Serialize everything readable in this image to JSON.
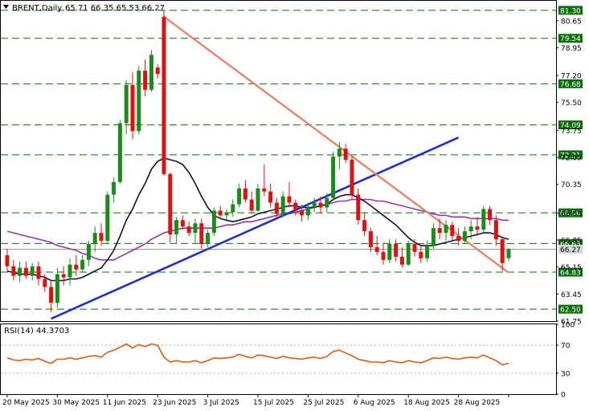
{
  "header": {
    "symbol": "BRENT,Daily",
    "ohlc": "65.71 66.35 65.53 66.27"
  },
  "rsi_header": "RSI(14) 44.3703",
  "colors": {
    "bull": "#1a8c1a",
    "bear": "#e01010",
    "sma_fast": "#101038",
    "sma_slow": "#9933b0",
    "support_line": "#1f2fd0",
    "resistance_line": "#f07a5a",
    "level_line": "#0a6e0a",
    "level_label_bg": "#0a6e0a",
    "price_label_bg": "#d8d8d8",
    "rsi_line": "#e05a10"
  },
  "chart_data": [
    {
      "type": "candlestick",
      "ylim": [
        61.75,
        81.9
      ],
      "yticks": [
        61.75,
        63.45,
        65.15,
        66.85,
        68.55,
        70.35,
        72.05,
        73.75,
        75.5,
        77.2,
        78.95,
        80.65
      ],
      "xticks": [
        {
          "label": "20 May 2025",
          "index": 0
        },
        {
          "label": "30 May 2025",
          "index": 8
        },
        {
          "label": "11 Jun 2025",
          "index": 16
        },
        {
          "label": "23 Jun 2025",
          "index": 24
        },
        {
          "label": "3 Jul 2025",
          "index": 32
        },
        {
          "label": "15 Jul 2025",
          "index": 40
        },
        {
          "label": "25 Jul 2025",
          "index": 48
        },
        {
          "label": "6 Aug 2025",
          "index": 56
        },
        {
          "label": "18 Aug 2025",
          "index": 64
        },
        {
          "label": "28 Aug 2025",
          "index": 72
        },
        {
          "label": "",
          "index": 80
        }
      ],
      "horizontal_levels": [
        81.3,
        79.54,
        76.68,
        74.09,
        72.21,
        68.56,
        66.63,
        64.83,
        62.5
      ],
      "current_price": 66.27,
      "candles": [
        {
          "o": 65.9,
          "h": 66.3,
          "l": 64.9,
          "c": 65.2
        },
        {
          "o": 65.2,
          "h": 65.6,
          "l": 64.3,
          "c": 64.6
        },
        {
          "o": 64.6,
          "h": 65.5,
          "l": 64.2,
          "c": 65.1
        },
        {
          "o": 65.1,
          "h": 65.5,
          "l": 64.4,
          "c": 64.6
        },
        {
          "o": 64.6,
          "h": 65.4,
          "l": 64.3,
          "c": 65.2
        },
        {
          "o": 65.2,
          "h": 65.5,
          "l": 64.0,
          "c": 64.4
        },
        {
          "o": 64.4,
          "h": 64.7,
          "l": 63.6,
          "c": 63.9
        },
        {
          "o": 63.9,
          "h": 64.3,
          "l": 62.3,
          "c": 62.9
        },
        {
          "o": 62.9,
          "h": 65.1,
          "l": 62.6,
          "c": 64.7
        },
        {
          "o": 64.7,
          "h": 65.2,
          "l": 64.0,
          "c": 64.5
        },
        {
          "o": 64.5,
          "h": 65.7,
          "l": 64.0,
          "c": 65.3
        },
        {
          "o": 65.3,
          "h": 65.9,
          "l": 64.6,
          "c": 65.0
        },
        {
          "o": 65.0,
          "h": 65.9,
          "l": 64.8,
          "c": 65.6
        },
        {
          "o": 65.6,
          "h": 66.8,
          "l": 65.2,
          "c": 66.6
        },
        {
          "o": 66.6,
          "h": 67.7,
          "l": 66.1,
          "c": 67.3
        },
        {
          "o": 67.3,
          "h": 67.9,
          "l": 66.5,
          "c": 66.8
        },
        {
          "o": 66.8,
          "h": 69.9,
          "l": 66.6,
          "c": 69.7
        },
        {
          "o": 69.7,
          "h": 70.8,
          "l": 69.2,
          "c": 70.5
        },
        {
          "o": 70.5,
          "h": 74.4,
          "l": 70.4,
          "c": 74.2
        },
        {
          "o": 74.2,
          "h": 76.9,
          "l": 73.5,
          "c": 76.6
        },
        {
          "o": 76.6,
          "h": 77.4,
          "l": 73.2,
          "c": 73.7
        },
        {
          "o": 73.7,
          "h": 77.8,
          "l": 73.5,
          "c": 77.5
        },
        {
          "o": 77.5,
          "h": 78.2,
          "l": 75.9,
          "c": 76.3
        },
        {
          "o": 76.3,
          "h": 78.8,
          "l": 76.2,
          "c": 78.5
        },
        {
          "o": 77.7,
          "h": 77.9,
          "l": 77.0,
          "c": 77.3
        },
        {
          "o": 80.9,
          "h": 81.3,
          "l": 70.9,
          "c": 71.0
        },
        {
          "o": 71.0,
          "h": 71.1,
          "l": 66.7,
          "c": 67.2
        },
        {
          "o": 67.2,
          "h": 68.3,
          "l": 66.6,
          "c": 68.1
        },
        {
          "o": 68.1,
          "h": 68.4,
          "l": 67.5,
          "c": 67.7
        },
        {
          "o": 67.7,
          "h": 68.0,
          "l": 67.1,
          "c": 67.3
        },
        {
          "o": 67.3,
          "h": 68.2,
          "l": 66.6,
          "c": 67.9
        },
        {
          "o": 67.9,
          "h": 68.2,
          "l": 66.3,
          "c": 66.6
        },
        {
          "o": 66.6,
          "h": 67.5,
          "l": 66.4,
          "c": 67.3
        },
        {
          "o": 67.3,
          "h": 68.9,
          "l": 67.1,
          "c": 68.7
        },
        {
          "o": 68.7,
          "h": 69.0,
          "l": 68.2,
          "c": 68.4
        },
        {
          "o": 68.4,
          "h": 68.8,
          "l": 68.0,
          "c": 68.6
        },
        {
          "o": 68.6,
          "h": 69.4,
          "l": 68.3,
          "c": 69.1
        },
        {
          "o": 69.1,
          "h": 70.4,
          "l": 68.9,
          "c": 70.1
        },
        {
          "o": 70.1,
          "h": 70.6,
          "l": 69.2,
          "c": 69.4
        },
        {
          "o": 69.4,
          "h": 69.9,
          "l": 68.5,
          "c": 68.7
        },
        {
          "o": 68.7,
          "h": 70.4,
          "l": 68.6,
          "c": 70.1
        },
        {
          "o": 70.1,
          "h": 71.6,
          "l": 69.6,
          "c": 69.9
        },
        {
          "o": 69.9,
          "h": 70.4,
          "l": 68.9,
          "c": 69.2
        },
        {
          "o": 69.2,
          "h": 69.5,
          "l": 68.3,
          "c": 68.5
        },
        {
          "o": 68.5,
          "h": 69.9,
          "l": 68.3,
          "c": 69.6
        },
        {
          "o": 69.6,
          "h": 70.5,
          "l": 68.9,
          "c": 69.2
        },
        {
          "o": 69.2,
          "h": 69.4,
          "l": 68.4,
          "c": 68.7
        },
        {
          "o": 68.7,
          "h": 69.1,
          "l": 68.0,
          "c": 68.4
        },
        {
          "o": 68.4,
          "h": 69.2,
          "l": 68.1,
          "c": 68.9
        },
        {
          "o": 68.9,
          "h": 69.5,
          "l": 68.6,
          "c": 69.2
        },
        {
          "o": 69.2,
          "h": 69.6,
          "l": 68.5,
          "c": 68.9
        },
        {
          "o": 68.9,
          "h": 69.8,
          "l": 68.6,
          "c": 69.5
        },
        {
          "o": 69.5,
          "h": 72.4,
          "l": 69.3,
          "c": 72.1
        },
        {
          "o": 72.1,
          "h": 73.0,
          "l": 71.3,
          "c": 72.6
        },
        {
          "o": 72.6,
          "h": 72.9,
          "l": 71.7,
          "c": 71.9
        },
        {
          "o": 71.9,
          "h": 72.1,
          "l": 69.4,
          "c": 69.7
        },
        {
          "o": 69.7,
          "h": 70.1,
          "l": 67.8,
          "c": 68.1
        },
        {
          "o": 68.1,
          "h": 68.6,
          "l": 67.1,
          "c": 67.4
        },
        {
          "o": 67.4,
          "h": 67.6,
          "l": 66.1,
          "c": 66.4
        },
        {
          "o": 66.4,
          "h": 67.1,
          "l": 65.9,
          "c": 66.1
        },
        {
          "o": 66.1,
          "h": 66.7,
          "l": 65.3,
          "c": 65.6
        },
        {
          "o": 65.6,
          "h": 66.9,
          "l": 65.4,
          "c": 66.6
        },
        {
          "o": 66.6,
          "h": 66.9,
          "l": 65.5,
          "c": 65.8
        },
        {
          "o": 65.8,
          "h": 66.4,
          "l": 65.1,
          "c": 65.3
        },
        {
          "o": 65.3,
          "h": 66.8,
          "l": 65.2,
          "c": 66.6
        },
        {
          "o": 66.6,
          "h": 66.9,
          "l": 65.8,
          "c": 66.1
        },
        {
          "o": 66.1,
          "h": 66.5,
          "l": 65.4,
          "c": 65.7
        },
        {
          "o": 65.7,
          "h": 66.8,
          "l": 65.5,
          "c": 66.5
        },
        {
          "o": 66.5,
          "h": 67.9,
          "l": 66.3,
          "c": 67.6
        },
        {
          "o": 67.6,
          "h": 68.2,
          "l": 66.9,
          "c": 67.3
        },
        {
          "o": 67.3,
          "h": 68.1,
          "l": 66.8,
          "c": 67.8
        },
        {
          "o": 67.8,
          "h": 68.0,
          "l": 66.8,
          "c": 67.1
        },
        {
          "o": 67.1,
          "h": 67.6,
          "l": 66.5,
          "c": 66.8
        },
        {
          "o": 66.8,
          "h": 67.7,
          "l": 66.6,
          "c": 67.4
        },
        {
          "o": 67.4,
          "h": 68.1,
          "l": 66.9,
          "c": 67.7
        },
        {
          "o": 67.7,
          "h": 68.3,
          "l": 67.1,
          "c": 67.5
        },
        {
          "o": 67.5,
          "h": 69.0,
          "l": 67.3,
          "c": 68.8
        },
        {
          "o": 68.8,
          "h": 69.0,
          "l": 67.8,
          "c": 68.1
        },
        {
          "o": 68.1,
          "h": 68.4,
          "l": 66.5,
          "c": 66.9
        },
        {
          "o": 66.9,
          "h": 67.0,
          "l": 64.9,
          "c": 65.4
        },
        {
          "o": 65.71,
          "h": 66.35,
          "l": 65.53,
          "c": 66.27
        }
      ],
      "sma_fast": [
        64.9,
        64.8,
        64.7,
        64.7,
        64.7,
        64.6,
        64.5,
        64.3,
        64.3,
        64.3,
        64.4,
        64.4,
        64.5,
        64.7,
        64.9,
        65.1,
        65.6,
        66.2,
        67.1,
        68.1,
        68.8,
        69.7,
        70.4,
        71.3,
        71.8,
        72.0,
        71.9,
        71.8,
        71.6,
        71.1,
        70.4,
        69.6,
        68.9,
        68.4,
        68.2,
        68.1,
        68.0,
        68.1,
        68.2,
        68.3,
        68.5,
        68.6,
        68.7,
        68.8,
        68.9,
        69.0,
        69.0,
        68.9,
        68.9,
        68.9,
        69.0,
        69.1,
        69.4,
        69.6,
        69.7,
        69.7,
        69.5,
        69.3,
        69.0,
        68.7,
        68.4,
        68.1,
        67.8,
        67.4,
        67.0,
        66.7,
        66.5,
        66.5,
        66.5,
        66.6,
        66.7,
        66.8,
        66.9,
        67.0,
        67.1,
        67.2,
        67.3,
        67.3,
        67.2,
        67.0,
        66.9
      ],
      "sma_slow": [
        67.4,
        67.3,
        67.2,
        67.1,
        67.0,
        66.9,
        66.8,
        66.7,
        66.5,
        66.4,
        66.3,
        66.2,
        66.0,
        65.9,
        65.7,
        65.6,
        65.6,
        65.6,
        65.8,
        66.0,
        66.2,
        66.4,
        66.6,
        66.9,
        67.1,
        67.3,
        67.4,
        67.5,
        67.6,
        67.6,
        67.6,
        67.6,
        67.6,
        67.6,
        67.7,
        67.8,
        67.8,
        67.9,
        68.0,
        68.0,
        68.1,
        68.2,
        68.3,
        68.4,
        68.5,
        68.5,
        68.6,
        68.7,
        68.8,
        68.9,
        69.0,
        69.1,
        69.2,
        69.3,
        69.3,
        69.4,
        69.4,
        69.4,
        69.4,
        69.3,
        69.3,
        69.2,
        69.1,
        69.0,
        68.9,
        68.8,
        68.7,
        68.6,
        68.5,
        68.4,
        68.4,
        68.3,
        68.3,
        68.3,
        68.2,
        68.2,
        68.2,
        68.2,
        68.2,
        68.1,
        68.1
      ],
      "trendlines": [
        {
          "name": "support",
          "from": {
            "index": 7,
            "value": 61.9
          },
          "to": {
            "index": 72,
            "value": 73.3
          }
        },
        {
          "name": "resistance",
          "from": {
            "index": 25,
            "value": 80.9
          },
          "to": {
            "index": 80,
            "value": 64.8
          }
        }
      ]
    },
    {
      "type": "line",
      "title": "RSI(14) 44.3703",
      "ylim": [
        0,
        100
      ],
      "yticks": [
        0,
        30,
        70,
        100
      ],
      "dashed_levels": [
        30,
        70
      ],
      "values": [
        52,
        49,
        48,
        50,
        49,
        51,
        47,
        44,
        50,
        50,
        52,
        50,
        52,
        54,
        55,
        53,
        60,
        63,
        67,
        72,
        66,
        71,
        68,
        72,
        70,
        53,
        46,
        48,
        46,
        46,
        48,
        45,
        48,
        52,
        51,
        52,
        53,
        57,
        54,
        52,
        56,
        55,
        53,
        51,
        54,
        52,
        51,
        50,
        52,
        53,
        51,
        54,
        61,
        63,
        59,
        55,
        50,
        48,
        46,
        46,
        45,
        48,
        46,
        45,
        48,
        46,
        45,
        48,
        52,
        51,
        53,
        51,
        50,
        52,
        53,
        52,
        56,
        52,
        48,
        42,
        44
      ]
    }
  ]
}
